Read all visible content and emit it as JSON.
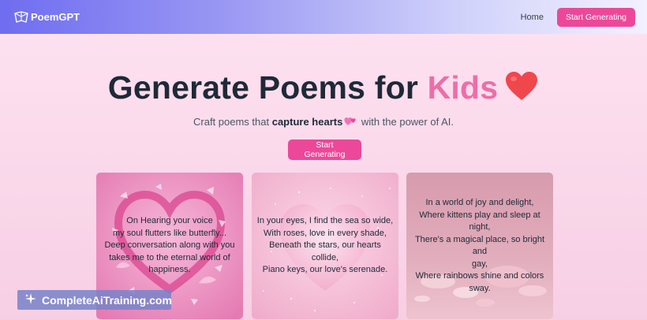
{
  "nav": {
    "brand": "PoemGPT",
    "home": "Home",
    "cta": "Start Generating"
  },
  "hero": {
    "title_main": "Generate Poems for ",
    "title_accent": "Kids",
    "subtitle_pre": "Craft poems that ",
    "subtitle_bold": "capture hearts",
    "subtitle_post": " with the power of AI.",
    "cta": "Start Generating"
  },
  "cards": [
    {
      "text": "On Hearing your voice\nmy soul flutters like butterfly...\nDeep conversation along with you\ntakes me to the eternal world of\nhappiness."
    },
    {
      "text": "In your eyes, I find the sea so wide,\nWith roses, love in every shade,\nBeneath the stars, our hearts collide,\nPiano keys, our love's serenade."
    },
    {
      "text": "In a world of joy and delight,\nWhere kittens play and sleep at night,\nThere's a magical place, so bright and\ngay,\nWhere rainbows shine and colors\nsway."
    }
  ],
  "watermark": {
    "text": "CompleteAiTraining.com"
  },
  "colors": {
    "accent_pink": "#ec4899",
    "title_accent": "#ec6ea9",
    "nav_gradient_start": "#6f6df0"
  },
  "icons": {
    "brand": "origami-logo-icon",
    "title_emoji": "red-heart-icon",
    "subtitle_emoji": "two-hearts-icon",
    "watermark": "sparkle-logo-icon"
  }
}
